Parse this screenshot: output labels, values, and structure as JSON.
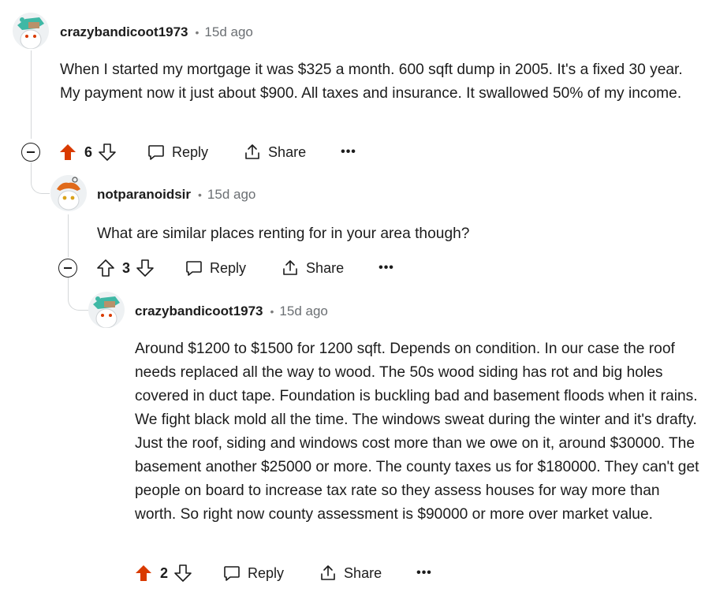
{
  "comments": [
    {
      "author": "crazybandicoot1973",
      "time": "15d ago",
      "text": "When I started my mortgage it was $325 a month. 600 sqft dump in 2005. It's a fixed 30 year. My payment now it just about $900. All taxes and insurance. It swallowed 50% of my income.",
      "votes": "6",
      "upvoted": true,
      "reply_label": "Reply",
      "share_label": "Share",
      "more_label": "•••"
    },
    {
      "author": "notparanoidsir",
      "time": "15d ago",
      "text": "What are similar places renting for in your area though?",
      "votes": "3",
      "upvoted": false,
      "reply_label": "Reply",
      "share_label": "Share",
      "more_label": "•••"
    },
    {
      "author": "crazybandicoot1973",
      "time": "15d ago",
      "text": "Around $1200 to $1500 for 1200 sqft. Depends on condition. In our case the roof needs replaced all the way to wood. The 50s wood siding has rot and big holes covered in duct tape. Foundation is buckling bad and basement floods when it rains. We fight black mold all the time. The windows sweat during the winter and it's drafty. Just the roof, siding and windows cost more than we owe on it, around $30000. The basement another $25000 or more. The county taxes us for $180000. They can't get people on board to increase tax rate so they assess houses for way more than worth. So right now county assessment is $90000 or more over market value.",
      "votes": "2",
      "upvoted": true,
      "reply_label": "Reply",
      "share_label": "Share",
      "more_label": "•••"
    }
  ],
  "separator": "•",
  "colors": {
    "upvote": "#d93a00",
    "line": "#d4d7d9",
    "meta": "#6b6f73"
  },
  "icons": [
    "collapse-icon",
    "upvote-icon",
    "downvote-icon",
    "reply-icon",
    "share-icon",
    "more-icon",
    "snoo-avatar-icon"
  ]
}
